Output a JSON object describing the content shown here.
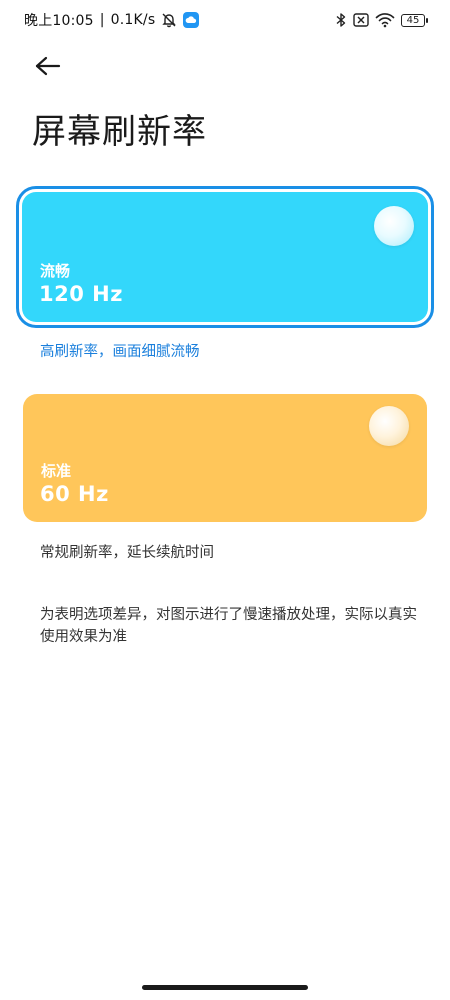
{
  "status_bar": {
    "time": "晚上10:05",
    "network_speed": "0.1K/s",
    "icons_left": [
      "mute-bell-icon",
      "cloud-app-icon"
    ],
    "icons_right": [
      "bluetooth-icon",
      "no-sim-icon",
      "wifi-icon",
      "battery-icon"
    ],
    "battery_level": "45",
    "cloud_color": "#2196f3"
  },
  "header": {
    "back_icon": "arrow-left-icon",
    "title": "屏幕刷新率"
  },
  "options": [
    {
      "name": "流畅",
      "rate": "120 Hz",
      "description": "高刷新率，画面细腻流畅",
      "selected": true,
      "card_color": "#33d7fb",
      "border_color": "#1a8fe6",
      "description_color": "#1a7fdc"
    },
    {
      "name": "标准",
      "rate": "60 Hz",
      "description": "常规刷新率，延长续航时间",
      "selected": false,
      "card_color": "#ffc65a",
      "description_color": "#333333"
    }
  ],
  "note": "为表明选项差异，对图示进行了慢速播放处理，实际以真实使用效果为准"
}
